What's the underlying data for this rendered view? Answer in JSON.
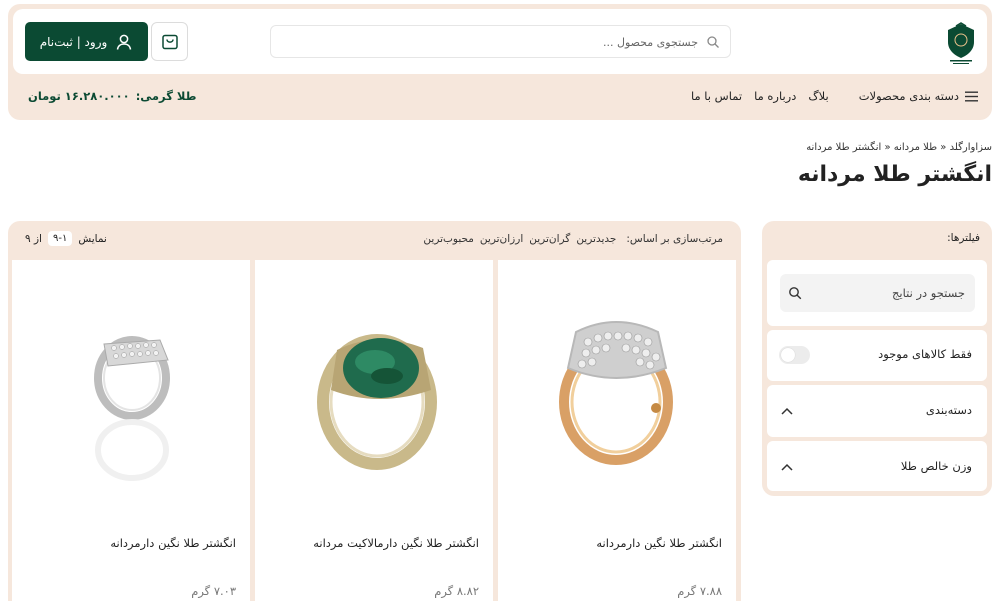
{
  "colors": {
    "brand": "#0b4a33",
    "panel": "#f6e7dc",
    "gold": "#e8c08a"
  },
  "header": {
    "logo_icon": "shield-crest-logo",
    "search_placeholder": "جستجوی محصول ...",
    "cart_icon": "shopping-bag-icon",
    "login_label": "ورود | ثبت‌نام",
    "user_icon": "user-icon"
  },
  "nav": {
    "menu_icon": "hamburger-icon",
    "items": [
      "دسته بندی محصولات",
      "بلاگ",
      "درباره ما",
      "تماس با ما"
    ],
    "gold_label": "طلا گرمی:",
    "gold_value": "۱۶.۲۸۰.۰۰۰ تومان"
  },
  "breadcrumb": "سزاوارگلد « طلا مردانه « انگشتر طلا مردانه",
  "page_title": "انگشتر طلا مردانه",
  "filters": {
    "title": "فیلترها:",
    "search_placeholder": "جستجو در نتایج",
    "in_stock_label": "فقط کالاهای موجود",
    "in_stock_on": false,
    "category_label": "دسته‌بندی",
    "weight_label": "وزن خالص طلا"
  },
  "sort": {
    "label": "مرتب‌سازی بر اساس:",
    "options": [
      "جدیدترین",
      "گران‌ترین",
      "ارزان‌ترین",
      "محبوب‌ترین"
    ]
  },
  "showing": {
    "label": "نمایش",
    "range": "۹-۱",
    "of_label": "از ۹"
  },
  "products": [
    {
      "name": "انگشتر طلا نگین دارمردانه",
      "weight": "۷.۸۸ گرم"
    },
    {
      "name": "انگشتر طلا نگین دارمالاکیت مردانه",
      "weight": "۸.۸۲ گرم"
    },
    {
      "name": "انگشتر طلا نگین دارمردانه",
      "weight": "۷.۰۳ گرم"
    }
  ]
}
